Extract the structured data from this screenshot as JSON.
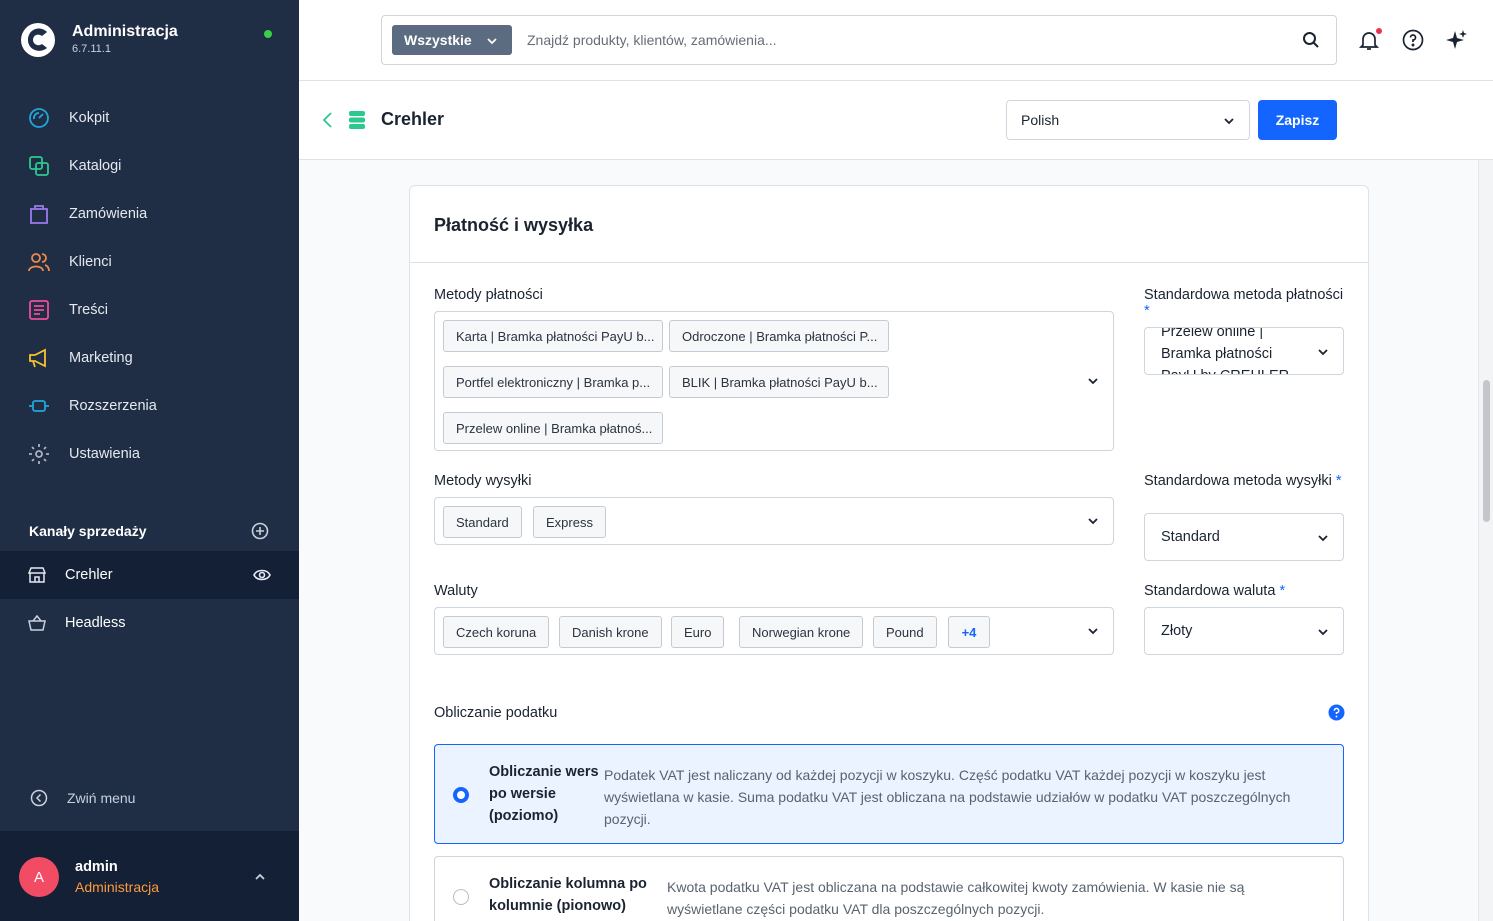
{
  "app": {
    "title": "Administracja",
    "version": "6.7.11.1"
  },
  "nav": [
    {
      "label": "Kokpit",
      "icon": "gauge-icon",
      "color": "#22a7d8"
    },
    {
      "label": "Katalogi",
      "icon": "catalog-icon",
      "color": "#2cc98f"
    },
    {
      "label": "Zamówienia",
      "icon": "bag-icon",
      "color": "#9a7af0"
    },
    {
      "label": "Klienci",
      "icon": "users-icon",
      "color": "#f08a4b"
    },
    {
      "label": "Treści",
      "icon": "content-icon",
      "color": "#f14c9a"
    },
    {
      "label": "Marketing",
      "icon": "megaphone-icon",
      "color": "#f5c32e"
    },
    {
      "label": "Rozszerzenia",
      "icon": "plugin-icon",
      "color": "#22a7d8"
    },
    {
      "label": "Ustawienia",
      "icon": "gear-icon",
      "color": "#aab3c0"
    }
  ],
  "channels": {
    "header": "Kanały sprzedaży",
    "items": [
      {
        "label": "Crehler",
        "active": true
      },
      {
        "label": "Headless",
        "active": false
      }
    ]
  },
  "collapse_label": "Zwiń menu",
  "user": {
    "initial": "A",
    "name": "admin",
    "role": "Administracja"
  },
  "search": {
    "type": "Wszystkie",
    "placeholder": "Znajdź produkty, klientów, zamówienia..."
  },
  "header": {
    "title": "Crehler",
    "language": "Polish",
    "save_label": "Zapisz"
  },
  "card": {
    "title": "Płatność i wysyłka",
    "payment": {
      "label": "Metody płatności",
      "tags": [
        "Karta | Bramka płatności PayU b...",
        "Odroczone | Bramka płatności P...",
        "Portfel elektroniczny | Bramka p...",
        "BLIK | Bramka płatności PayU b...",
        "Przelew online | Bramka płatnoś..."
      ],
      "default_label": "Standardowa metoda płatności",
      "default_value": "Przelew online | Bramka płatności PayU by CREHLER"
    },
    "shipping": {
      "label": "Metody wysyłki",
      "tags": [
        "Standard",
        "Express"
      ],
      "default_label": "Standardowa metoda wysyłki",
      "default_value": "Standard"
    },
    "currency": {
      "label": "Waluty",
      "tags": [
        "Czech koruna",
        "Danish krone",
        "Euro",
        "Norwegian krone",
        "Pound"
      ],
      "more": "+4",
      "default_label": "Standardowa waluta",
      "default_value": "Złoty"
    },
    "tax": {
      "label": "Obliczanie podatku",
      "options": [
        {
          "title": "Obliczanie wers po wersie (poziomo)",
          "description": "Podatek VAT jest naliczany od każdej pozycji w koszyku. Część podatku VAT każdej pozycji w koszyku jest wyświetlana w kasie. Suma podatku VAT jest obliczana na podstawie udziałów w podatku VAT poszczególnych pozycji.",
          "selected": true
        },
        {
          "title": "Obliczanie kolumna po kolumnie (pionowo)",
          "description": "Kwota podatku VAT jest obliczana na podstawie całkowitej kwoty zamówienia. W kasie nie są wyświetlane części podatku VAT dla poszczególnych pozycji.",
          "selected": false
        }
      ]
    }
  },
  "colors": {
    "accent": "#1465ff",
    "sidebar": "#1f2d45",
    "status_online": "#37d046",
    "avatar": "#f14c63",
    "role": "#ff9a3c"
  }
}
